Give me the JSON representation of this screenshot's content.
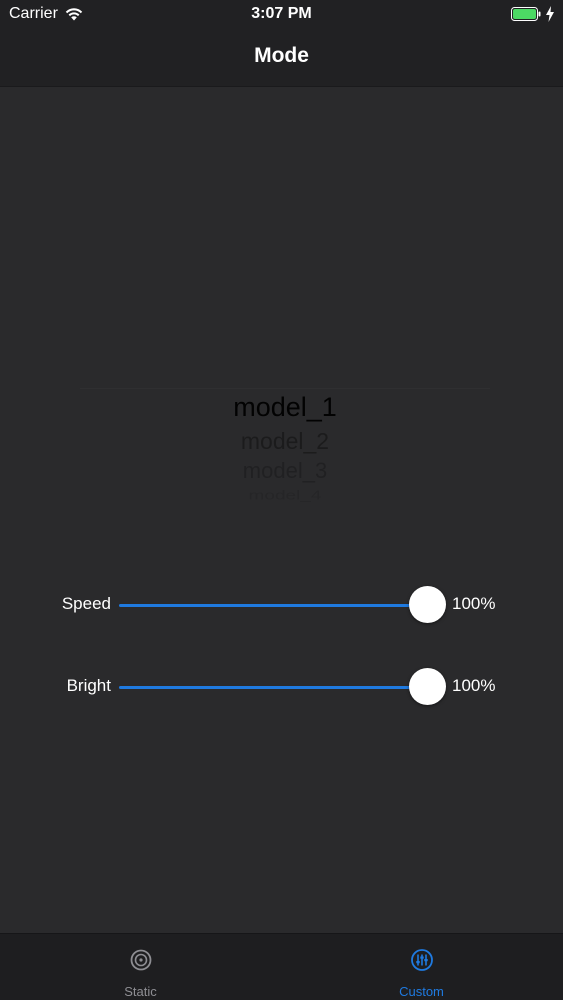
{
  "status_bar": {
    "carrier": "Carrier",
    "time": "3:07 PM",
    "icons": [
      "wifi-icon",
      "battery-icon",
      "charging-icon"
    ]
  },
  "nav": {
    "title": "Mode"
  },
  "picker": {
    "items": [
      "model_1",
      "model_2",
      "model_3",
      "model_4"
    ],
    "selected": "model_1"
  },
  "sliders": {
    "speed": {
      "label": "Speed",
      "value_text": "100%",
      "value": 1.0
    },
    "bright": {
      "label": "Bright",
      "value_text": "100%",
      "value": 1.0
    }
  },
  "tab_bar": {
    "tabs": [
      {
        "label": "Static",
        "icon": "static-disc-icon",
        "active": false
      },
      {
        "label": "Custom",
        "icon": "sliders-icon",
        "active": true
      }
    ]
  },
  "colors": {
    "accent": "#1f7ae0",
    "inactive_tab": "#8e8e93",
    "background": "#2a2a2c",
    "bar_background": "#212123",
    "battery": "#4cd964"
  }
}
